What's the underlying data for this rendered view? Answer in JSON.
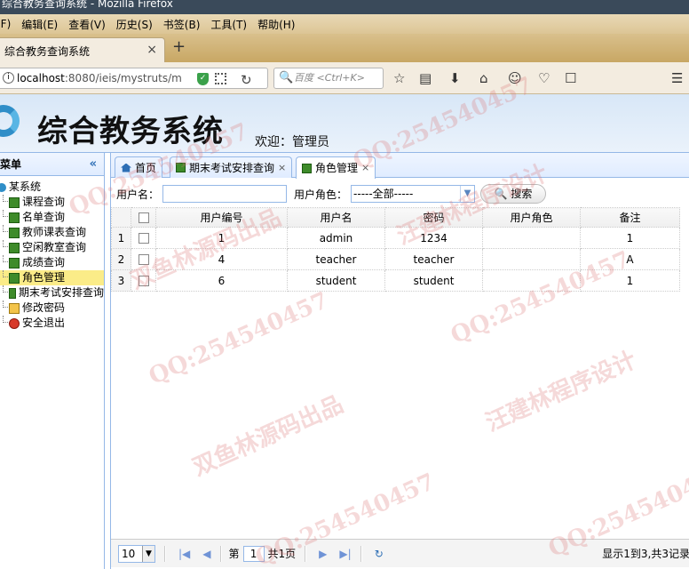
{
  "window": {
    "title": "综合教务查询系统 - Mozilla Firefox"
  },
  "menu": [
    "(F)",
    "编辑(E)",
    "查看(V)",
    "历史(S)",
    "书签(B)",
    "工具(T)",
    "帮助(H)"
  ],
  "browser_tab": {
    "title": "综合教务查询系统",
    "close": "×",
    "new_tab": "+"
  },
  "navbar": {
    "url_host": "localhost",
    "url_rest": ":8080/ieis/mystruts/m",
    "search_placeholder": "百度 <Ctrl+K>"
  },
  "app": {
    "title": "综合教务系统",
    "welcome": "欢迎：管理员"
  },
  "sidebar": {
    "header": "菜单",
    "collapse": "«",
    "root": "某系统",
    "items": [
      {
        "label": "课程查询",
        "icon": "book-icon"
      },
      {
        "label": "名单查询",
        "icon": "book-icon"
      },
      {
        "label": "教师课表查询",
        "icon": "book-icon"
      },
      {
        "label": "空闲教室查询",
        "icon": "book-icon"
      },
      {
        "label": "成绩查询",
        "icon": "book-icon"
      },
      {
        "label": "角色管理",
        "icon": "book-icon",
        "selected": true
      },
      {
        "label": "期末考试安排查询",
        "icon": "book-icon"
      },
      {
        "label": "修改密码",
        "icon": "lock-icon"
      },
      {
        "label": "安全退出",
        "icon": "exit-icon"
      }
    ]
  },
  "tabs": [
    {
      "label": "首页",
      "closable": false
    },
    {
      "label": "期末考试安排查询",
      "closable": true
    },
    {
      "label": "角色管理",
      "closable": true,
      "active": true
    }
  ],
  "toolbar": {
    "username_label": "用户名：",
    "username_value": "",
    "role_label": "用户角色：",
    "role_value": "-----全部-----",
    "search_button": "搜索"
  },
  "grid": {
    "columns": [
      "用户编号",
      "用户名",
      "密码",
      "用户角色",
      "备注"
    ],
    "rows": [
      {
        "num": "1",
        "id": "1",
        "username": "admin",
        "password": "1234",
        "role": "",
        "remark": "1"
      },
      {
        "num": "2",
        "id": "4",
        "username": "teacher",
        "password": "teacher",
        "role": "",
        "remark": "A"
      },
      {
        "num": "3",
        "id": "6",
        "username": "student",
        "password": "student",
        "role": "",
        "remark": "1"
      }
    ]
  },
  "pager": {
    "page_size": "10",
    "page_prefix": "第",
    "page_value": "1",
    "page_total": "共1页",
    "summary": "显示1到3,共3记录"
  },
  "watermarks": [
    "QQ:254540457",
    "双鱼林源码出品",
    "汪建林程序设计"
  ]
}
